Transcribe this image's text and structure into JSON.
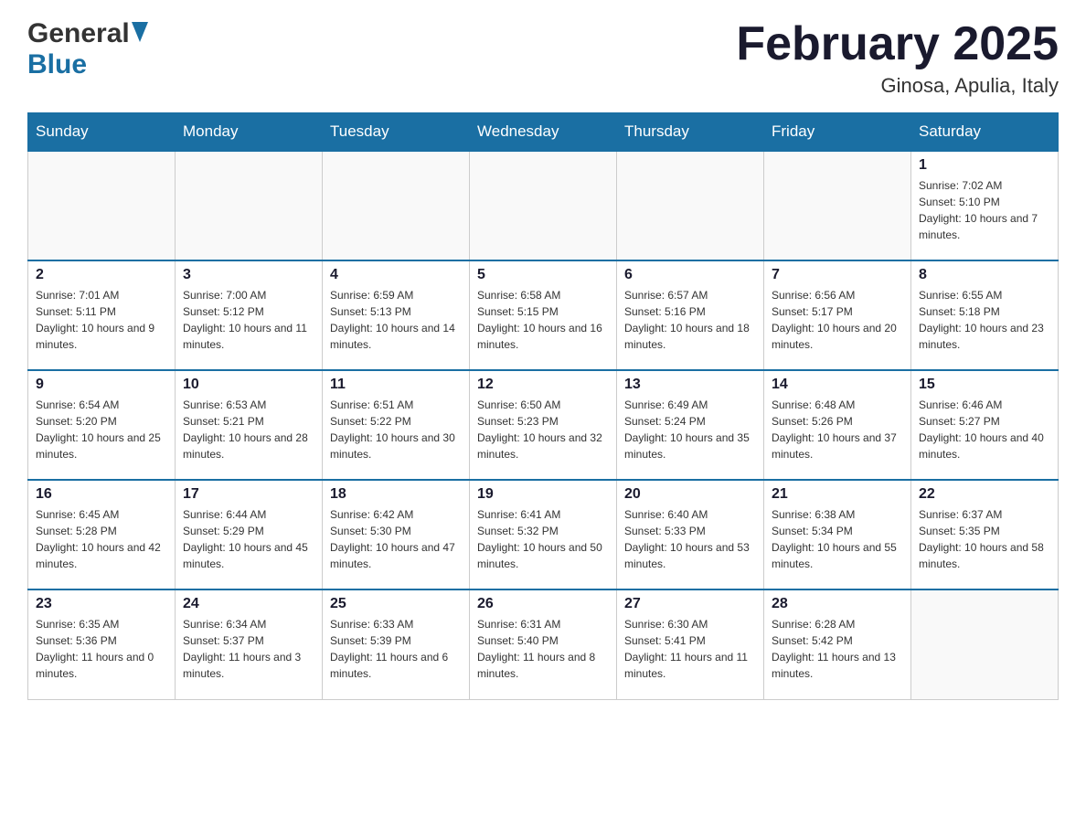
{
  "header": {
    "logo_general": "General",
    "logo_blue": "Blue",
    "month_year": "February 2025",
    "location": "Ginosa, Apulia, Italy"
  },
  "weekdays": [
    "Sunday",
    "Monday",
    "Tuesday",
    "Wednesday",
    "Thursday",
    "Friday",
    "Saturday"
  ],
  "weeks": [
    [
      {
        "day": "",
        "info": ""
      },
      {
        "day": "",
        "info": ""
      },
      {
        "day": "",
        "info": ""
      },
      {
        "day": "",
        "info": ""
      },
      {
        "day": "",
        "info": ""
      },
      {
        "day": "",
        "info": ""
      },
      {
        "day": "1",
        "info": "Sunrise: 7:02 AM\nSunset: 5:10 PM\nDaylight: 10 hours and 7 minutes."
      }
    ],
    [
      {
        "day": "2",
        "info": "Sunrise: 7:01 AM\nSunset: 5:11 PM\nDaylight: 10 hours and 9 minutes."
      },
      {
        "day": "3",
        "info": "Sunrise: 7:00 AM\nSunset: 5:12 PM\nDaylight: 10 hours and 11 minutes."
      },
      {
        "day": "4",
        "info": "Sunrise: 6:59 AM\nSunset: 5:13 PM\nDaylight: 10 hours and 14 minutes."
      },
      {
        "day": "5",
        "info": "Sunrise: 6:58 AM\nSunset: 5:15 PM\nDaylight: 10 hours and 16 minutes."
      },
      {
        "day": "6",
        "info": "Sunrise: 6:57 AM\nSunset: 5:16 PM\nDaylight: 10 hours and 18 minutes."
      },
      {
        "day": "7",
        "info": "Sunrise: 6:56 AM\nSunset: 5:17 PM\nDaylight: 10 hours and 20 minutes."
      },
      {
        "day": "8",
        "info": "Sunrise: 6:55 AM\nSunset: 5:18 PM\nDaylight: 10 hours and 23 minutes."
      }
    ],
    [
      {
        "day": "9",
        "info": "Sunrise: 6:54 AM\nSunset: 5:20 PM\nDaylight: 10 hours and 25 minutes."
      },
      {
        "day": "10",
        "info": "Sunrise: 6:53 AM\nSunset: 5:21 PM\nDaylight: 10 hours and 28 minutes."
      },
      {
        "day": "11",
        "info": "Sunrise: 6:51 AM\nSunset: 5:22 PM\nDaylight: 10 hours and 30 minutes."
      },
      {
        "day": "12",
        "info": "Sunrise: 6:50 AM\nSunset: 5:23 PM\nDaylight: 10 hours and 32 minutes."
      },
      {
        "day": "13",
        "info": "Sunrise: 6:49 AM\nSunset: 5:24 PM\nDaylight: 10 hours and 35 minutes."
      },
      {
        "day": "14",
        "info": "Sunrise: 6:48 AM\nSunset: 5:26 PM\nDaylight: 10 hours and 37 minutes."
      },
      {
        "day": "15",
        "info": "Sunrise: 6:46 AM\nSunset: 5:27 PM\nDaylight: 10 hours and 40 minutes."
      }
    ],
    [
      {
        "day": "16",
        "info": "Sunrise: 6:45 AM\nSunset: 5:28 PM\nDaylight: 10 hours and 42 minutes."
      },
      {
        "day": "17",
        "info": "Sunrise: 6:44 AM\nSunset: 5:29 PM\nDaylight: 10 hours and 45 minutes."
      },
      {
        "day": "18",
        "info": "Sunrise: 6:42 AM\nSunset: 5:30 PM\nDaylight: 10 hours and 47 minutes."
      },
      {
        "day": "19",
        "info": "Sunrise: 6:41 AM\nSunset: 5:32 PM\nDaylight: 10 hours and 50 minutes."
      },
      {
        "day": "20",
        "info": "Sunrise: 6:40 AM\nSunset: 5:33 PM\nDaylight: 10 hours and 53 minutes."
      },
      {
        "day": "21",
        "info": "Sunrise: 6:38 AM\nSunset: 5:34 PM\nDaylight: 10 hours and 55 minutes."
      },
      {
        "day": "22",
        "info": "Sunrise: 6:37 AM\nSunset: 5:35 PM\nDaylight: 10 hours and 58 minutes."
      }
    ],
    [
      {
        "day": "23",
        "info": "Sunrise: 6:35 AM\nSunset: 5:36 PM\nDaylight: 11 hours and 0 minutes."
      },
      {
        "day": "24",
        "info": "Sunrise: 6:34 AM\nSunset: 5:37 PM\nDaylight: 11 hours and 3 minutes."
      },
      {
        "day": "25",
        "info": "Sunrise: 6:33 AM\nSunset: 5:39 PM\nDaylight: 11 hours and 6 minutes."
      },
      {
        "day": "26",
        "info": "Sunrise: 6:31 AM\nSunset: 5:40 PM\nDaylight: 11 hours and 8 minutes."
      },
      {
        "day": "27",
        "info": "Sunrise: 6:30 AM\nSunset: 5:41 PM\nDaylight: 11 hours and 11 minutes."
      },
      {
        "day": "28",
        "info": "Sunrise: 6:28 AM\nSunset: 5:42 PM\nDaylight: 11 hours and 13 minutes."
      },
      {
        "day": "",
        "info": ""
      }
    ]
  ]
}
